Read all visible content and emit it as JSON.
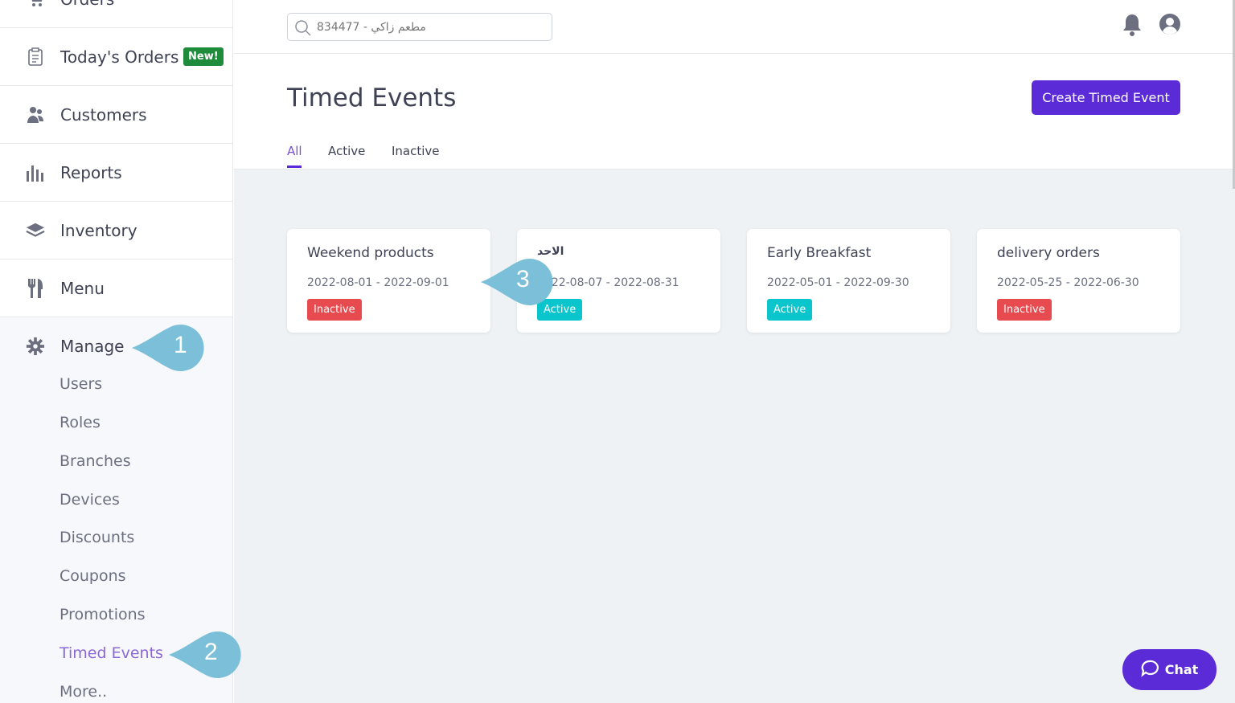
{
  "sidebar": {
    "items": [
      {
        "label": "Orders"
      },
      {
        "label": "Today's Orders",
        "badge": "New!"
      },
      {
        "label": "Customers"
      },
      {
        "label": "Reports"
      },
      {
        "label": "Inventory"
      },
      {
        "label": "Menu"
      },
      {
        "label": "Manage"
      }
    ],
    "manage_sub": [
      "Users",
      "Roles",
      "Branches",
      "Devices",
      "Discounts",
      "Coupons",
      "Promotions",
      "Timed Events",
      "More.."
    ]
  },
  "header": {
    "search_placeholder": "مطعم زاكي - 834477"
  },
  "page": {
    "title": "Timed Events",
    "create_button": "Create Timed Event",
    "tabs": [
      "All",
      "Active",
      "Inactive"
    ],
    "active_tab": "All"
  },
  "cards": [
    {
      "name": "Weekend products",
      "dates": "2022-08-01 - 2022-09-01",
      "status": "Inactive"
    },
    {
      "name": "الاحد",
      "dates": "2022-08-07 - 2022-08-31",
      "status": "Active"
    },
    {
      "name": "Early Breakfast",
      "dates": "2022-05-01 - 2022-09-30",
      "status": "Active"
    },
    {
      "name": "delivery orders",
      "dates": "2022-05-25 - 2022-06-30",
      "status": "Inactive"
    }
  ],
  "callouts": [
    "1",
    "2",
    "3"
  ],
  "chat": {
    "label": "Chat"
  },
  "colors": {
    "primary": "#5c2bd8",
    "inactive": "#e84b4f",
    "active": "#0bc5cc",
    "callout": "#7bbfd8"
  }
}
